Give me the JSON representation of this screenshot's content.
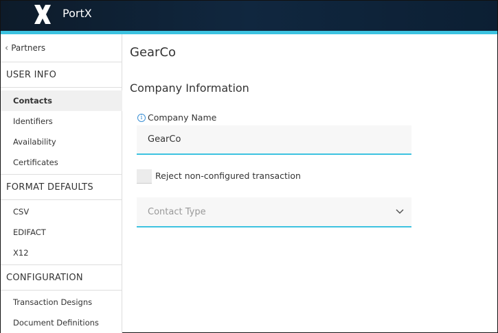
{
  "header": {
    "brand": "PortX",
    "logo_icon": "portx-x-logo",
    "accent_color": "#3cc2e0",
    "background_color": "#0d1b2a"
  },
  "sidebar": {
    "back_label": "Partners",
    "sections": [
      {
        "title": "USER INFO",
        "items": [
          {
            "label": "Contacts",
            "active": true
          },
          {
            "label": "Identifiers",
            "active": false
          },
          {
            "label": "Availability",
            "active": false
          },
          {
            "label": "Certificates",
            "active": false
          }
        ]
      },
      {
        "title": "FORMAT DEFAULTS",
        "items": [
          {
            "label": "CSV",
            "active": false
          },
          {
            "label": "EDIFACT",
            "active": false
          },
          {
            "label": "X12",
            "active": false
          }
        ]
      },
      {
        "title": "CONFIGURATION",
        "items": [
          {
            "label": "Transaction Designs",
            "active": false
          },
          {
            "label": "Document Definitions",
            "active": false
          }
        ]
      }
    ]
  },
  "main": {
    "page_title": "GearCo",
    "section_title": "Company Information",
    "company_name_label": "Company Name",
    "company_name_value": "GearCo",
    "reject_label": "Reject non-configured transaction",
    "contact_type_placeholder": "Contact Type"
  }
}
